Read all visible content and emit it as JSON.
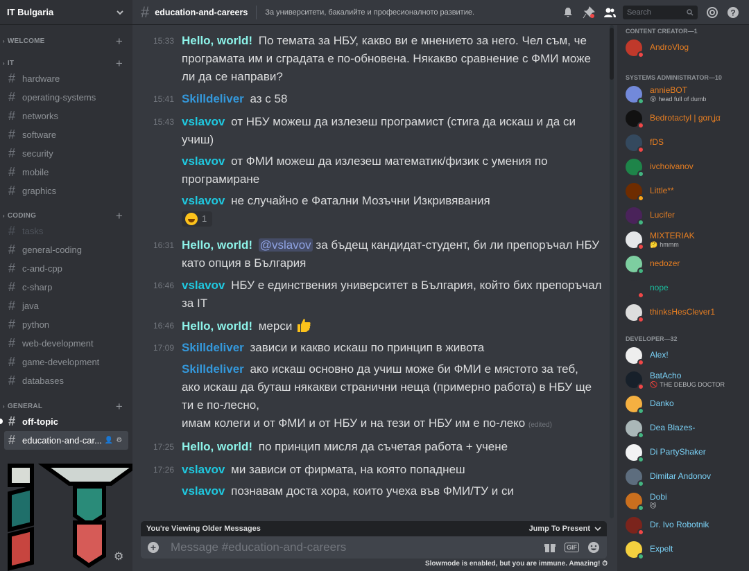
{
  "server": {
    "name": "IT Bulgaria"
  },
  "sidebar": {
    "categories": [
      {
        "name": "WELCOME"
      },
      {
        "name": "IT",
        "channels": [
          "hardware",
          "operating-systems",
          "networks",
          "software",
          "security",
          "mobile",
          "graphics"
        ]
      },
      {
        "name": "CODING",
        "channels": [
          "tasks",
          "general-coding",
          "c-and-cpp",
          "c-sharp",
          "java",
          "python",
          "web-development",
          "game-development",
          "databases"
        ]
      },
      {
        "name": "GENERAL",
        "channels": [
          "off-topic",
          "education-and-car..."
        ]
      }
    ]
  },
  "topbar": {
    "channel": "education-and-careers",
    "topic": "За университети, бакалийте и професионалното развитие.",
    "search_placeholder": "Search"
  },
  "messages": [
    {
      "time": "15:33",
      "author": "Hello, world!",
      "text": "По темата за НБУ, какво ви е мнението за него. Чел съм, че програмата им и сградата е по-обновена. Някакво сравнение с ФМИ може ли да се направи?"
    },
    {
      "time": "15:41",
      "author": "Skilldeliver",
      "text": "аз с 58"
    },
    {
      "time": "15:43",
      "author": "vslavov",
      "text": "от НБУ можеш да излезеш програмист (стига да искаш и да си учиш)"
    },
    {
      "author": "vslavov",
      "text": "от ФМИ можеш да излезеш математик/физик с умения по програмиране"
    },
    {
      "author": "vslavov",
      "text": "не случайно е Фатални Мозъчни Изкривявания",
      "reaction_count": "1"
    },
    {
      "time": "16:31",
      "author": "Hello, world!",
      "mention": "@vslavov",
      "text": "за бъдещ кандидат-студент, би ли препоръчал НБУ като опция в България"
    },
    {
      "time": "16:46",
      "author": "vslavov",
      "text": "НБУ е единствения университет в България, който бих препоръчал за IT"
    },
    {
      "time": "16:46",
      "author": "Hello, world!",
      "text": "мерси"
    },
    {
      "time": "17:09",
      "author": "Skilldeliver",
      "text": "зависи и какво искаш по принцип в живота"
    },
    {
      "author": "Skilldeliver",
      "text": "ако искаш основно да учиш може би ФМИ е мястото за теб,",
      "line2": "ако искаш да буташ някакви странични неща (примерно работа) в НБУ ще ти е по-лесно,",
      "line3": "имам колеги и от ФМИ и от НБУ и на тези от НБУ им е по-леко",
      "edited": "(edited)"
    },
    {
      "time": "17:25",
      "author": "Hello, world!",
      "text": "по принцип мисля да съчетая работа + учене"
    },
    {
      "time": "17:26",
      "author": "vslavov",
      "text": "ми зависи от фирмата, на която попаднеш"
    },
    {
      "author": "vslavov",
      "text": "познавам доста хора, които учеха във ФМИ/ТУ и си"
    }
  ],
  "older_banner": {
    "label": "You're Viewing Older Messages",
    "jump": "Jump To Present"
  },
  "composer": {
    "placeholder": "Message #education-and-careers"
  },
  "slowmode": "Slowmode is enabled, but you are immune. Amazing!",
  "members": {
    "groups": [
      {
        "title": "CONTENT CREATOR—1",
        "list": [
          {
            "name": "AndroVlog"
          }
        ]
      },
      {
        "title": "SYSTEMS ADMINISTRATOR—10",
        "list": [
          {
            "name": "annieBOT",
            "sub": "head full of dumb"
          },
          {
            "name": "Bedrotactyl | gαnʝα"
          },
          {
            "name": "fDS"
          },
          {
            "name": "ivchoivanov"
          },
          {
            "name": "Little**"
          },
          {
            "name": "Lucifer"
          },
          {
            "name": "MIXTERIAK",
            "sub": "hmmm"
          },
          {
            "name": "nedozer"
          },
          {
            "name": "nope"
          },
          {
            "name": "thinksHesClever1"
          }
        ]
      },
      {
        "title": "DEVELOPER—32",
        "list": [
          {
            "name": "Alex!"
          },
          {
            "name": "BatAcho",
            "sub": "THE DEBUG DOCTOR"
          },
          {
            "name": "Danko"
          },
          {
            "name": "Dea Blazes-"
          },
          {
            "name": "Di PartyShaker"
          },
          {
            "name": "Dimitar Andonov"
          },
          {
            "name": "Dobi"
          },
          {
            "name": "Dr. Ivo Robotnik"
          },
          {
            "name": "Expelt"
          }
        ]
      }
    ]
  },
  "colors": {
    "bg": "#36393f",
    "sidebar": "#2f3136",
    "accent_cyan": "#1fc9e0",
    "hello": "#8df3e9",
    "orange": "#e67e22"
  }
}
